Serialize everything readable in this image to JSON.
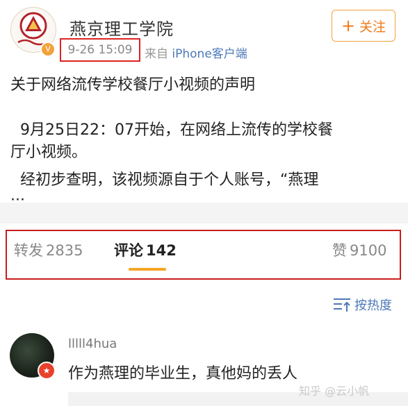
{
  "header": {
    "account_name": "燕京理工学院",
    "post_time": "9-26 15:09",
    "from_prefix": "来自",
    "from_source": "iPhone客户端",
    "follow_label": "关注",
    "follow_plus": "+",
    "verified_mark": "V"
  },
  "post": {
    "title": "关于网络流传学校餐厅小视频的声明",
    "lines": [
      "  9月25日22：07开始，在网络上流传的学校餐",
      "厅小视频。",
      "  经初步查明，该视频源自于个人账号，“燕理",
      "···"
    ]
  },
  "stats": {
    "repost_label": "转发",
    "repost_count": "2835",
    "comment_label": "评论",
    "comment_count": "142",
    "like_label": "赞",
    "like_count": "9100"
  },
  "sort": {
    "label": "按热度"
  },
  "comment": {
    "username": "lllll4hua",
    "text": "作为燕理的毕业生，真他妈的丢人",
    "badge": "★"
  },
  "watermark": "知乎 @云小帆"
}
